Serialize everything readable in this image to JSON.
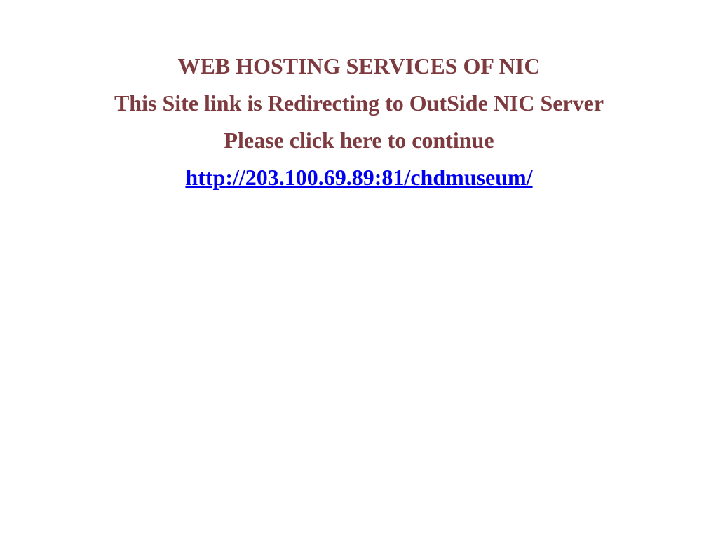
{
  "notice": {
    "heading": "WEB HOSTING SERVICES OF NIC",
    "message": "This Site link is Redirecting to OutSide NIC Server",
    "instruction": "Please click here to continue",
    "link_text": "http://203.100.69.89:81/chdmuseum/",
    "link_href": "http://203.100.69.89:81/chdmuseum/"
  },
  "colors": {
    "text": "#7e3b3f",
    "link": "#0000ee",
    "background": "#ffffff"
  }
}
